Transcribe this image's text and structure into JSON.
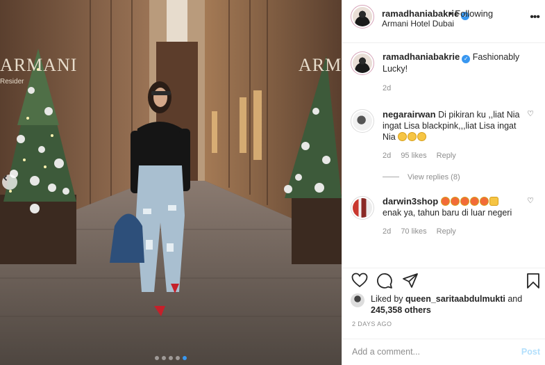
{
  "post": {
    "username": "ramadhaniabakrie",
    "following_label": "• Following",
    "location": "Armani Hotel Dubai",
    "caption": "Fashionably Lucky!",
    "caption_age": "2d",
    "signage_left": "ARMANI",
    "signage_left_sub": "Resider",
    "signage_right": "ARM"
  },
  "comments": [
    {
      "username": "negarairwan",
      "text": "Di pikiran ku ,,liat Nia ingat Lisa blackpink,,,liat Lisa ingat Nia",
      "age": "2d",
      "likes": "95 likes",
      "reply": "Reply"
    },
    {
      "username": "darwin3shop",
      "text": "enak ya, tahun baru di luar negeri",
      "age": "2d",
      "likes": "70 likes",
      "reply": "Reply"
    }
  ],
  "view_replies": "View replies (8)",
  "likes_line": {
    "prefix": "Liked by",
    "user": "queen_saritaabdulmukti",
    "middle": "and",
    "count": "245,358 others"
  },
  "posted_ago": "2 DAYS AGO",
  "add_comment_placeholder": "Add a comment...",
  "post_label": "Post",
  "icons": {
    "like": "heart-icon",
    "comment": "comment-icon",
    "share": "paper-plane-icon",
    "save": "bookmark-icon",
    "more": "more-dots-icon",
    "prev": "chevron-left-icon"
  },
  "colors": {
    "accent": "#3897f0",
    "post_disabled": "#b2dffc"
  },
  "carousel": {
    "count": 5,
    "active_index": 4
  }
}
